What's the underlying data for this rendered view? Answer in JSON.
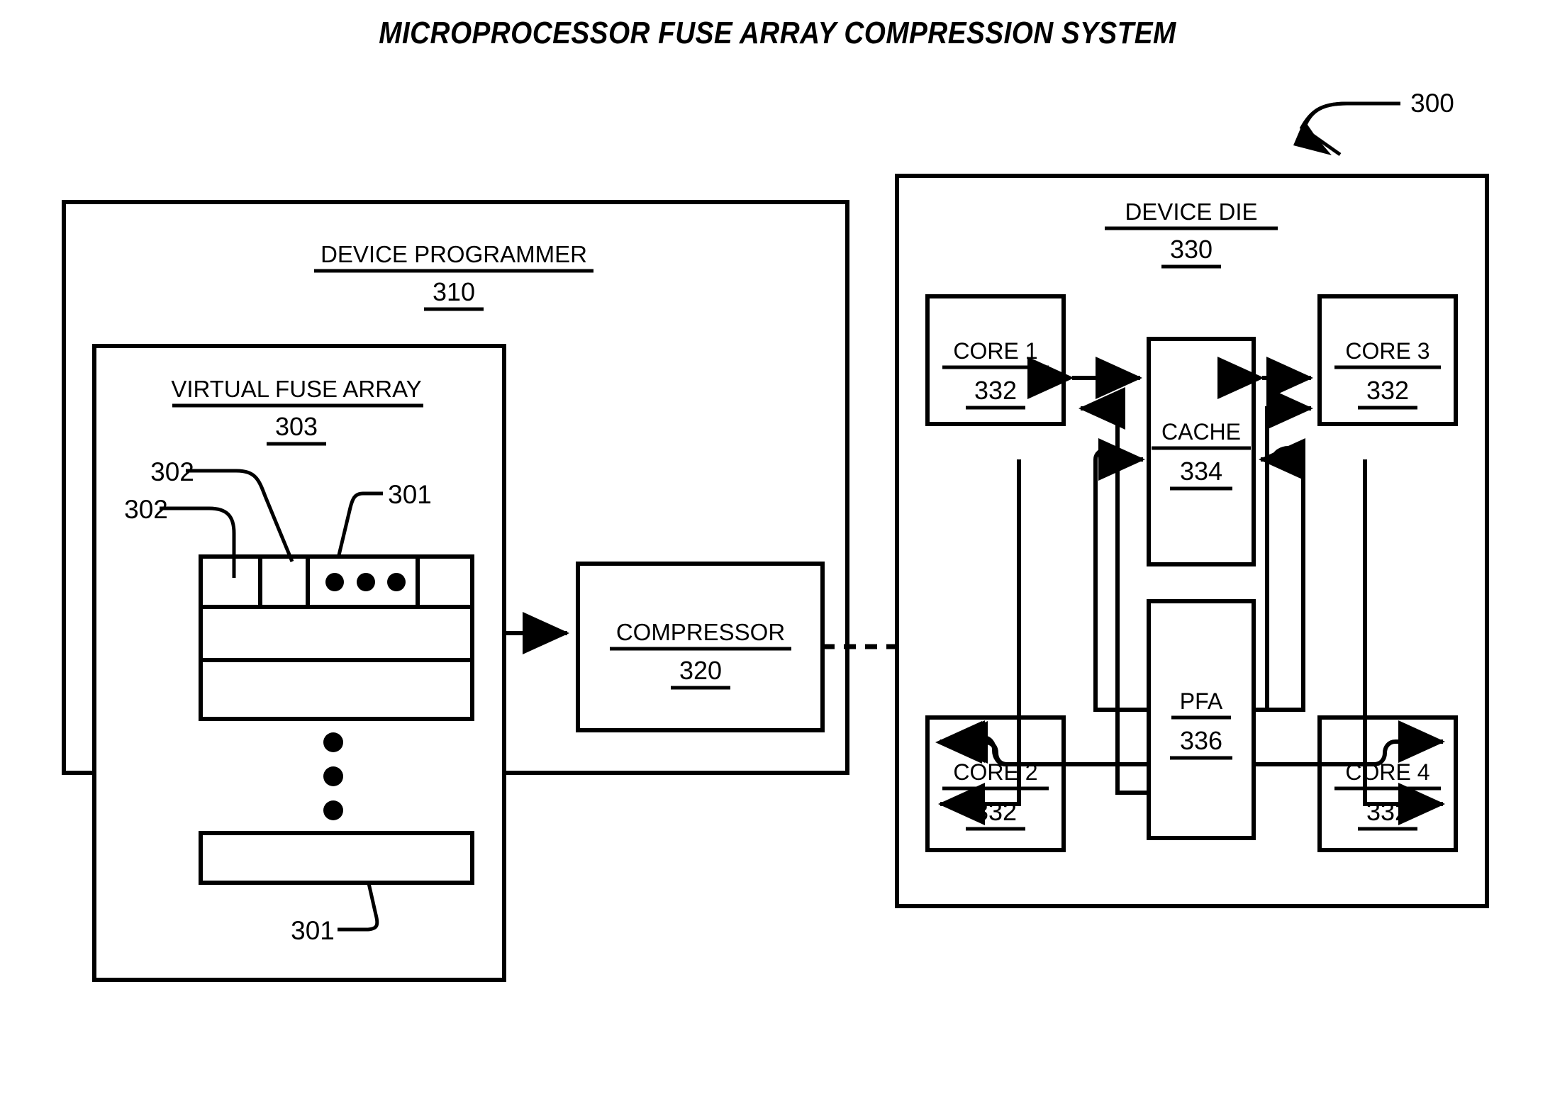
{
  "figure": {
    "title": "MICROPROCESSOR FUSE ARRAY COMPRESSION SYSTEM",
    "system_reference": "300"
  },
  "device_programmer": {
    "label": "DEVICE PROGRAMMER",
    "ref": "310"
  },
  "virtual_fuse_array": {
    "label": "VIRTUAL FUSE ARRAY",
    "ref": "303",
    "row_callout": "301",
    "row_callout_bottom": "301",
    "cell_callout_a": "302",
    "cell_callout_b": "302",
    "ellipsis_horizontal": "•••",
    "ellipsis_vertical": "•••"
  },
  "compressor": {
    "label": "COMPRESSOR",
    "ref": "320"
  },
  "device_die": {
    "label": "DEVICE DIE",
    "ref": "330"
  },
  "cores": [
    {
      "label": "CORE 1",
      "ref": "332"
    },
    {
      "label": "CORE 2",
      "ref": "332"
    },
    {
      "label": "CORE 3",
      "ref": "332"
    },
    {
      "label": "CORE 4",
      "ref": "332"
    }
  ],
  "cache": {
    "label": "CACHE",
    "ref": "334"
  },
  "pfa": {
    "label": "PFA",
    "ref": "336"
  },
  "colors": {
    "stroke": "#000000",
    "background": "#ffffff"
  }
}
